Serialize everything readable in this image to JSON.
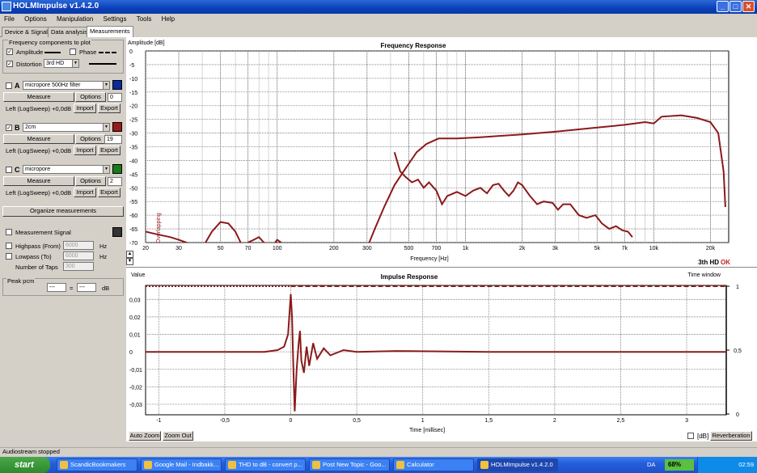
{
  "window": {
    "title": "HOLMImpulse  v1.4.2.0"
  },
  "menu": [
    "File",
    "Options",
    "Manipulation",
    "Settings",
    "Tools",
    "Help"
  ],
  "tabs": [
    "Device & Signal",
    "Data analysis",
    "Measurements"
  ],
  "freq_components": {
    "label": "Frequency components to plot",
    "amplitude": "Amplitude",
    "phase": "Phase",
    "distortion": "Distortion",
    "distortion_value": "3rd HD"
  },
  "measurements": [
    {
      "letter": "A",
      "checked": false,
      "name": "micropore 500Hz filter",
      "color": "#0a2a9a",
      "options_value": "0",
      "info": "Left (LogSweep) +0,0dB"
    },
    {
      "letter": "B",
      "checked": true,
      "name": "2cm",
      "color": "#9a1a1a",
      "options_value": "19",
      "info": "Left (LogSweep) +0,0dB"
    },
    {
      "letter": "C",
      "checked": false,
      "name": "micropore",
      "color": "#1a7a1a",
      "options_value": "2",
      "info": "Left (LogSweep) +0,0dB"
    }
  ],
  "buttons": {
    "measure": "Measure",
    "options": "Options",
    "import": "Import",
    "export": "Export",
    "organize": "Organize measurements",
    "auto_zoom": "Auto Zoom",
    "zoom_out": "Zoom Out",
    "reverberation": "Reverberation"
  },
  "signal": {
    "label": "Measurement Signal",
    "highpass": "Highpass (From)",
    "highpass_value": "6000",
    "lowpass": "Lowpass (To)",
    "lowpass_value": "6000",
    "taps": "Number of Taps",
    "taps_value": "300",
    "unit": "Hz"
  },
  "peak": {
    "label": "Peak pcm",
    "value1": "---",
    "eq": "=",
    "value2": "---",
    "unit": "dB"
  },
  "status": "Audiostream stopped",
  "chart_data": [
    {
      "type": "line",
      "title": "Frequency Response",
      "ylabel": "Amplitude [dB]",
      "xlabel": "Frequency [Hz]",
      "x_scale": "log",
      "xlim": [
        20,
        25000
      ],
      "ylim": [
        -70,
        0
      ],
      "yticks": [
        0,
        -5,
        -10,
        -15,
        -20,
        -25,
        -30,
        -35,
        -40,
        -45,
        -50,
        -55,
        -60,
        -65,
        -70
      ],
      "yticklabels": [
        "0",
        "-5",
        "-10",
        "-15",
        "-20",
        "-25",
        "-30",
        "-35",
        "-40",
        "-45",
        "-50",
        "-55",
        "-60",
        "-65",
        "-70"
      ],
      "xticks": [
        20,
        30,
        50,
        70,
        100,
        200,
        300,
        500,
        700,
        1000,
        2000,
        3000,
        5000,
        7000,
        10000,
        20000
      ],
      "xticklabels": [
        "20",
        "30",
        "50",
        "70",
        "100",
        "200",
        "300",
        "500",
        "700",
        "1k",
        "2k",
        "3k",
        "5k",
        "7k",
        "10k",
        "20k"
      ],
      "annotation": "Overlapping",
      "legend_note": "3th HD",
      "legend_note_suffix": "OK",
      "grid": true,
      "series": [
        {
          "role": "amplitude",
          "color": "#8b1a1a",
          "points": [
            [
              300,
              -72
            ],
            [
              330,
              -65
            ],
            [
              370,
              -57
            ],
            [
              420,
              -49
            ],
            [
              480,
              -43
            ],
            [
              550,
              -37
            ],
            [
              620,
              -34
            ],
            [
              720,
              -32
            ],
            [
              900,
              -32
            ],
            [
              1200,
              -31.5
            ],
            [
              2000,
              -30.5
            ],
            [
              3000,
              -29.5
            ],
            [
              5000,
              -28
            ],
            [
              7000,
              -27
            ],
            [
              9000,
              -26
            ],
            [
              10000,
              -26.5
            ],
            [
              11000,
              -24
            ],
            [
              14000,
              -23.5
            ],
            [
              17000,
              -24.5
            ],
            [
              20000,
              -26
            ],
            [
              22000,
              -30
            ],
            [
              23500,
              -44
            ],
            [
              24000,
              -57
            ]
          ]
        },
        {
          "role": "distortion",
          "color": "#8b1a1a",
          "points": [
            [
              420,
              -37
            ],
            [
              450,
              -44
            ],
            [
              480,
              -46
            ],
            [
              520,
              -48
            ],
            [
              560,
              -47
            ],
            [
              600,
              -50
            ],
            [
              640,
              -48
            ],
            [
              700,
              -51
            ],
            [
              750,
              -56
            ],
            [
              800,
              -53
            ],
            [
              900,
              -51.5
            ],
            [
              1000,
              -53
            ],
            [
              1100,
              -51
            ],
            [
              1200,
              -50
            ],
            [
              1300,
              -52
            ],
            [
              1400,
              -49
            ],
            [
              1500,
              -48.5
            ],
            [
              1600,
              -51
            ],
            [
              1700,
              -53
            ],
            [
              1800,
              -51
            ],
            [
              1900,
              -48
            ],
            [
              2000,
              -49
            ],
            [
              2200,
              -53
            ],
            [
              2400,
              -56
            ],
            [
              2600,
              -55
            ],
            [
              2900,
              -55.5
            ],
            [
              3100,
              -58
            ],
            [
              3300,
              -56
            ],
            [
              3600,
              -56
            ],
            [
              4000,
              -60
            ],
            [
              4400,
              -61
            ],
            [
              4900,
              -60
            ],
            [
              5300,
              -63
            ],
            [
              5800,
              -65
            ],
            [
              6300,
              -64
            ],
            [
              6800,
              -65.5
            ],
            [
              7300,
              -66
            ],
            [
              7700,
              -68
            ]
          ]
        },
        {
          "role": "distortion-low",
          "color": "#8b1a1a",
          "points": [
            [
              20,
              -66
            ],
            [
              23,
              -67
            ],
            [
              27,
              -68
            ],
            [
              30,
              -69
            ],
            [
              40,
              -72
            ],
            [
              45,
              -66
            ],
            [
              50,
              -62.5
            ],
            [
              55,
              -63
            ],
            [
              60,
              -66
            ],
            [
              65,
              -71
            ],
            [
              75,
              -69
            ],
            [
              80,
              -68
            ],
            [
              85,
              -70
            ],
            [
              95,
              -71
            ],
            [
              100,
              -69
            ],
            [
              105,
              -70
            ]
          ]
        }
      ]
    },
    {
      "type": "line",
      "title": "Impulse Response",
      "ylabel": "Value",
      "xlabel": "Time [millisec]",
      "y2label": "Time window",
      "xlim": [
        -1.1,
        3.3
      ],
      "ylim": [
        -0.036,
        0.038
      ],
      "xticks": [
        -1,
        -0.5,
        0,
        0.5,
        1,
        1.5,
        2,
        2.5,
        3
      ],
      "xticklabels": [
        "-1",
        "-0,5",
        "0",
        "0,5",
        "1",
        "1,5",
        "2",
        "2,5",
        "3"
      ],
      "yticks": [
        0.03,
        0.02,
        0.01,
        0,
        -0.01,
        -0.02,
        -0.03
      ],
      "yticklabels": [
        "0,03",
        "0,02",
        "0,01",
        "0",
        "-0,01",
        "-0,02",
        "-0,03"
      ],
      "y2ticks": [
        1,
        0.5,
        0
      ],
      "y2ticklabels": [
        "1",
        "0,5",
        "0"
      ],
      "dB_label": "[dB]",
      "grid": true,
      "window": {
        "start": 0,
        "level": 1
      },
      "series": [
        {
          "role": "impulse",
          "color": "#8b1a1a",
          "points": [
            [
              -1.1,
              0
            ],
            [
              -0.5,
              0
            ],
            [
              -0.2,
              0
            ],
            [
              -0.1,
              0.001
            ],
            [
              -0.05,
              0.003
            ],
            [
              -0.02,
              0.01
            ],
            [
              0,
              0.033
            ],
            [
              0.01,
              0.02
            ],
            [
              0.02,
              -0.01
            ],
            [
              0.03,
              -0.034
            ],
            [
              0.045,
              -0.01
            ],
            [
              0.06,
              0.005
            ],
            [
              0.07,
              0.012
            ],
            [
              0.08,
              -0.005
            ],
            [
              0.1,
              -0.012
            ],
            [
              0.12,
              0.003
            ],
            [
              0.14,
              -0.008
            ],
            [
              0.17,
              0.005
            ],
            [
              0.2,
              -0.004
            ],
            [
              0.25,
              0.002
            ],
            [
              0.3,
              -0.002
            ],
            [
              0.4,
              0.001
            ],
            [
              0.5,
              0
            ],
            [
              0.8,
              0.0005
            ],
            [
              1.5,
              0
            ],
            [
              3.3,
              0
            ]
          ]
        }
      ]
    }
  ]
}
